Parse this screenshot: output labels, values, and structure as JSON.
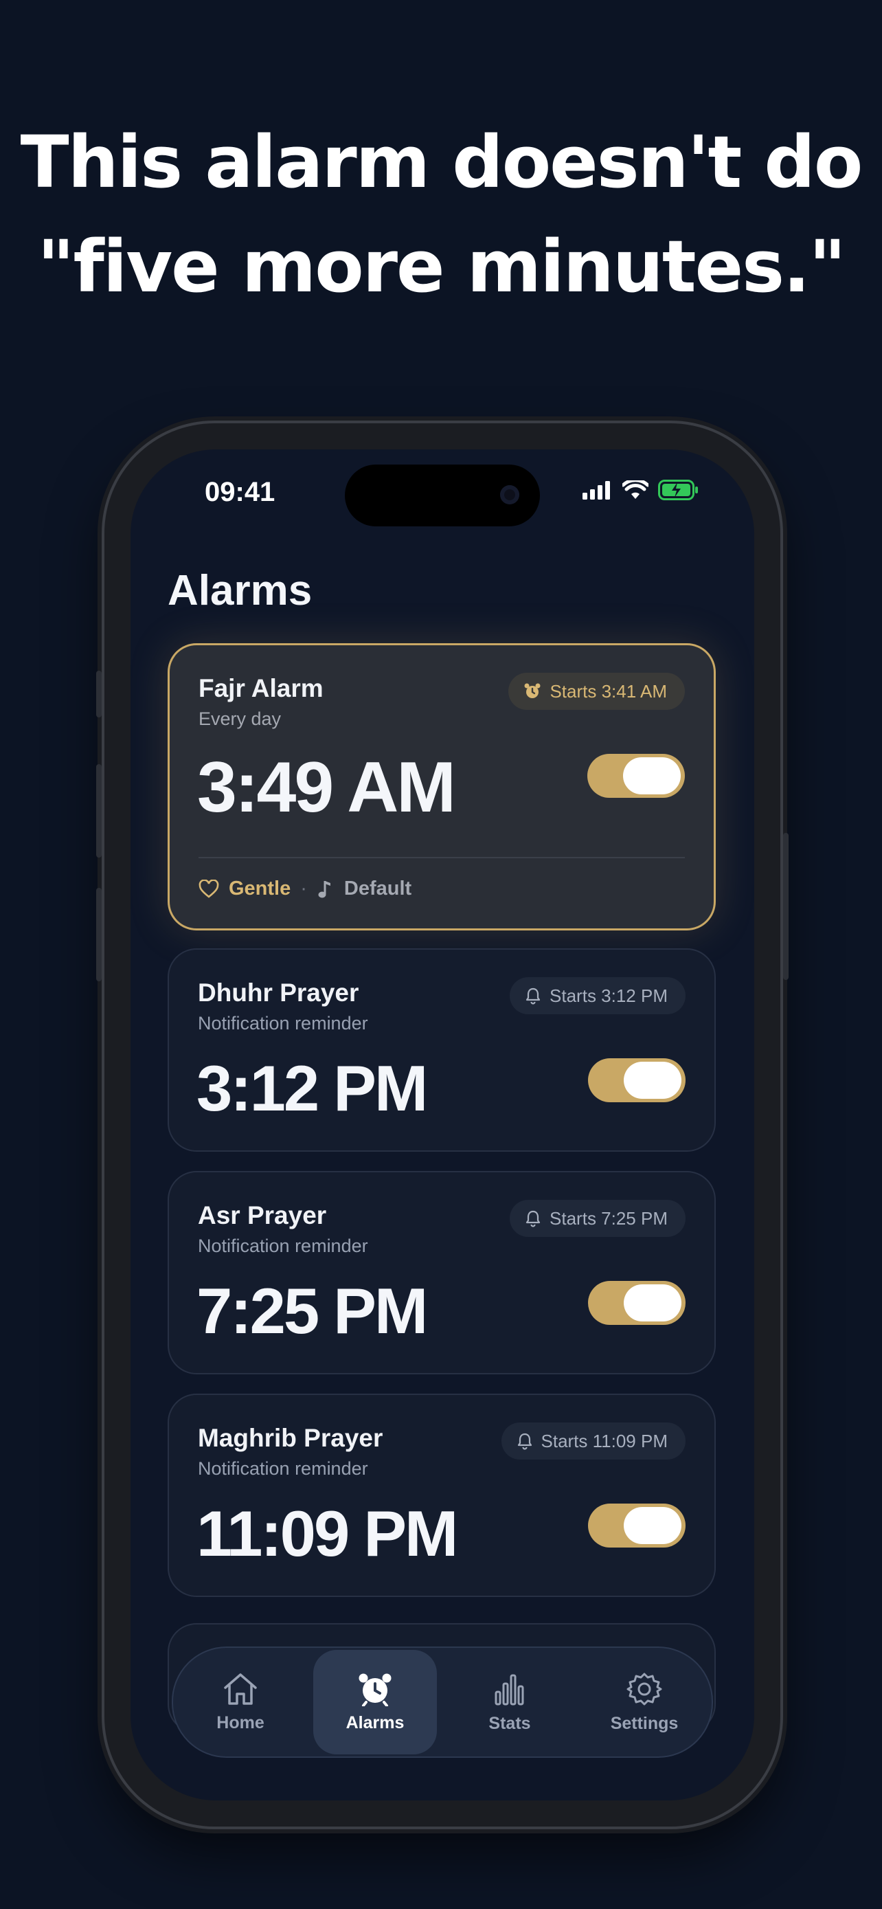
{
  "headline": {
    "line1": "This alarm doesn't do",
    "line2": "\"five more minutes.\""
  },
  "status_bar": {
    "time": "09:41",
    "icons": [
      "cellular-icon",
      "wifi-icon",
      "battery-charging-icon"
    ]
  },
  "page_title": "Alarms",
  "alarms": [
    {
      "name": "Fajr Alarm",
      "subtitle": "Every day",
      "pill_icon": "alarm-clock-icon",
      "starts": "Starts 3:41 AM",
      "time": "3:49 AM",
      "enabled": true,
      "mode": "Gentle",
      "sound": "Default",
      "separator": "·"
    },
    {
      "name": "Dhuhr Prayer",
      "subtitle": "Notification reminder",
      "pill_icon": "bell-icon",
      "starts": "Starts 3:12 PM",
      "time": "3:12 PM",
      "enabled": true
    },
    {
      "name": "Asr Prayer",
      "subtitle": "Notification reminder",
      "pill_icon": "bell-icon",
      "starts": "Starts 7:25 PM",
      "time": "7:25 PM",
      "enabled": true
    },
    {
      "name": "Maghrib Prayer",
      "subtitle": "Notification reminder",
      "pill_icon": "bell-icon",
      "starts": "Starts 11:09 PM",
      "time": "11:09 PM",
      "enabled": true
    }
  ],
  "tabs": [
    {
      "label": "Home",
      "icon": "home-icon"
    },
    {
      "label": "Alarms",
      "icon": "alarm-clock-icon",
      "active": true
    },
    {
      "label": "Stats",
      "icon": "bar-chart-icon"
    },
    {
      "label": "Settings",
      "icon": "gear-icon"
    }
  ],
  "colors": {
    "background": "#0c1424",
    "accent": "#c9a865",
    "card": "#141c2d",
    "active_card": "#2a2e36"
  }
}
